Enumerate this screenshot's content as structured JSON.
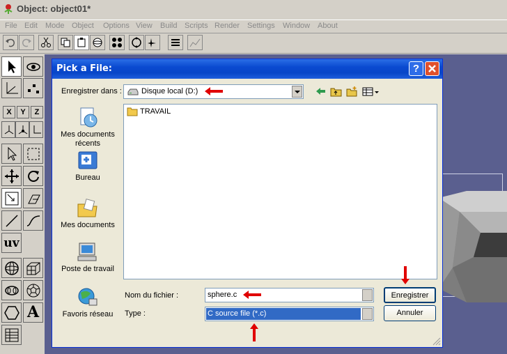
{
  "app": {
    "title": "Object: object01*",
    "menu": [
      "File",
      "Edit",
      "Mode",
      "Object",
      "Options",
      "View",
      "Build",
      "Scripts",
      "Render",
      "Settings",
      "Window",
      "About"
    ]
  },
  "palette": {
    "axis_x": "X",
    "axis_y": "Y",
    "axis_z": "Z",
    "uv_label": "uv",
    "text_tool": "A"
  },
  "dialog": {
    "title": "Pick a File:",
    "help": "?",
    "save_in_label": "Enregistrer dans :",
    "save_in_value": "Disque local (D:)",
    "places": [
      "Mes documents récents",
      "Bureau",
      "Mes documents",
      "Poste de travail",
      "Favoris réseau"
    ],
    "files": [
      "TRAVAIL"
    ],
    "filename_label": "Nom du fichier :",
    "filename_value": "sphere.c",
    "type_label": "Type :",
    "type_value": "C source file (*.c)",
    "save_button": "Enregistrer",
    "cancel_button": "Annuler"
  },
  "colors": {
    "annotation_arrow": "#e00000",
    "titlebar": "#0a4ad0",
    "canvas": "#5a5f8f"
  }
}
